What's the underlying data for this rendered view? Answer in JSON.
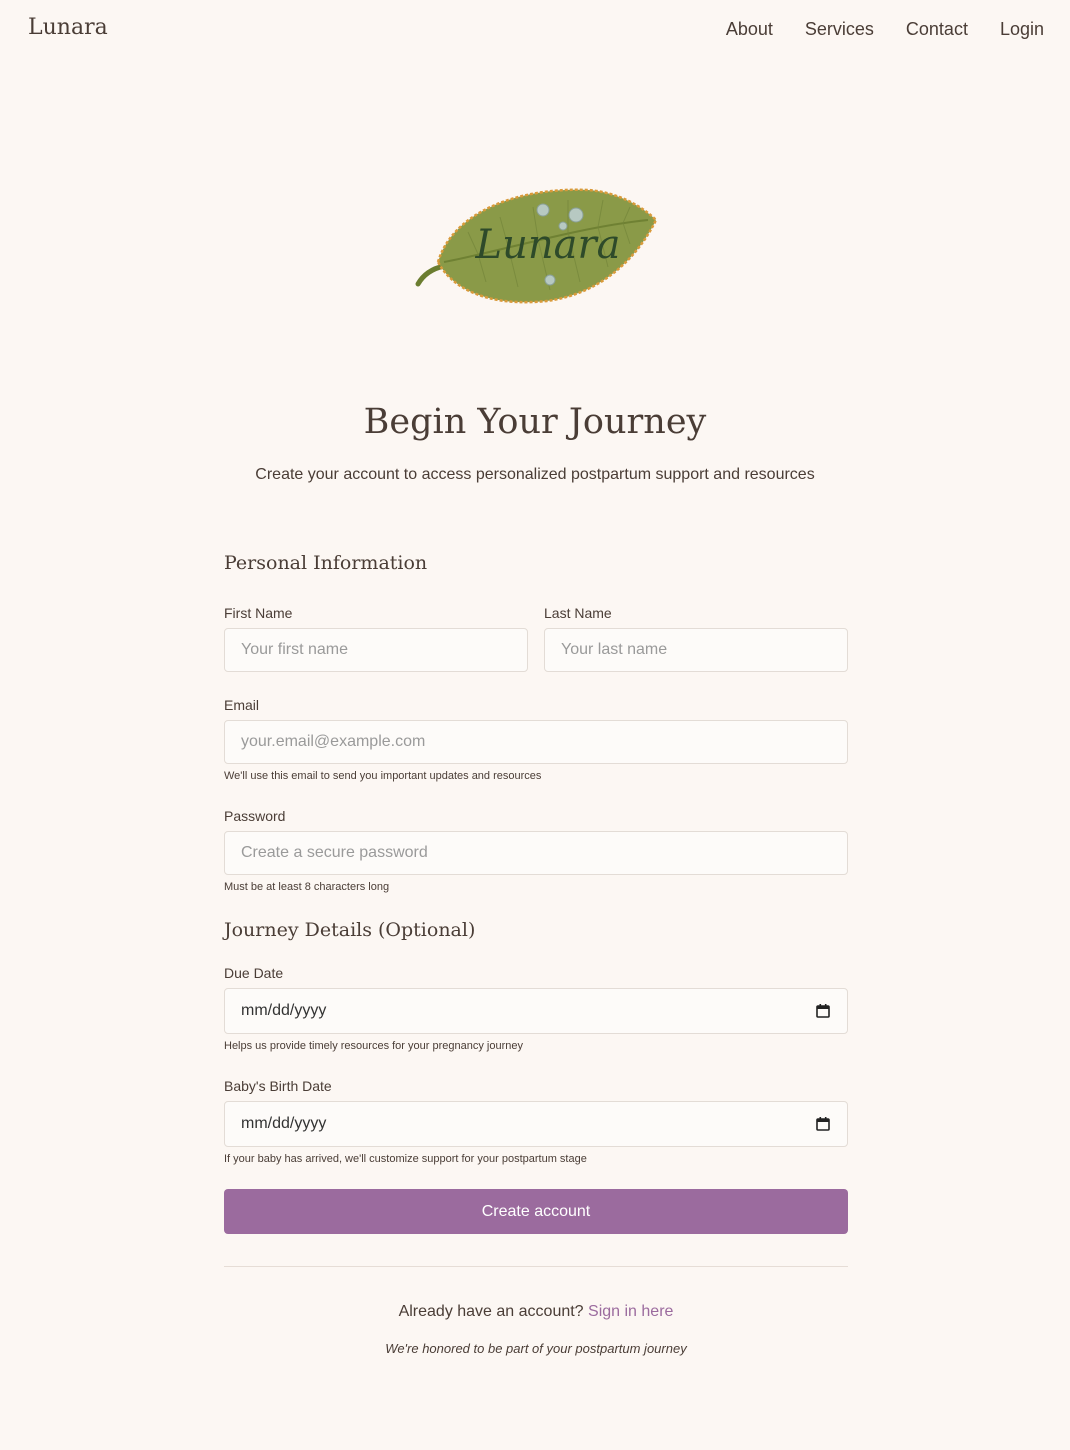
{
  "nav": {
    "brand": "Lunara",
    "links": [
      "About",
      "Services",
      "Contact",
      "Login"
    ]
  },
  "logo": {
    "text": "Lunara"
  },
  "header": {
    "title": "Begin Your Journey",
    "subtitle": "Create your account to access personalized postpartum support and resources"
  },
  "personal": {
    "section_title": "Personal Information",
    "first_name_label": "First Name",
    "first_name_placeholder": "Your first name",
    "last_name_label": "Last Name",
    "last_name_placeholder": "Your last name",
    "email_label": "Email",
    "email_placeholder": "your.email@example.com",
    "email_hint": "We'll use this email to send you important updates and resources",
    "password_label": "Password",
    "password_placeholder": "Create a secure password",
    "password_hint": "Must be at least 8 characters long"
  },
  "journey": {
    "section_title": "Journey Details (Optional)",
    "due_date_label": "Due Date",
    "due_date_value": "mm/dd/yyyy",
    "due_date_hint": "Helps us provide timely resources for your pregnancy journey",
    "birth_date_label": "Baby's Birth Date",
    "birth_date_value": "mm/dd/yyyy",
    "birth_date_hint": "If your baby has arrived, we'll customize support for your postpartum stage"
  },
  "submit_label": "Create account",
  "signin": {
    "prompt": "Already have an account?",
    "link": "Sign in here"
  },
  "footer_note": "We're honored to be part of your postpartum journey",
  "colors": {
    "background": "#fcf7f3",
    "accent": "#9b6b9e",
    "text": "#4a3d36",
    "leaf": "#7d8f3e"
  }
}
